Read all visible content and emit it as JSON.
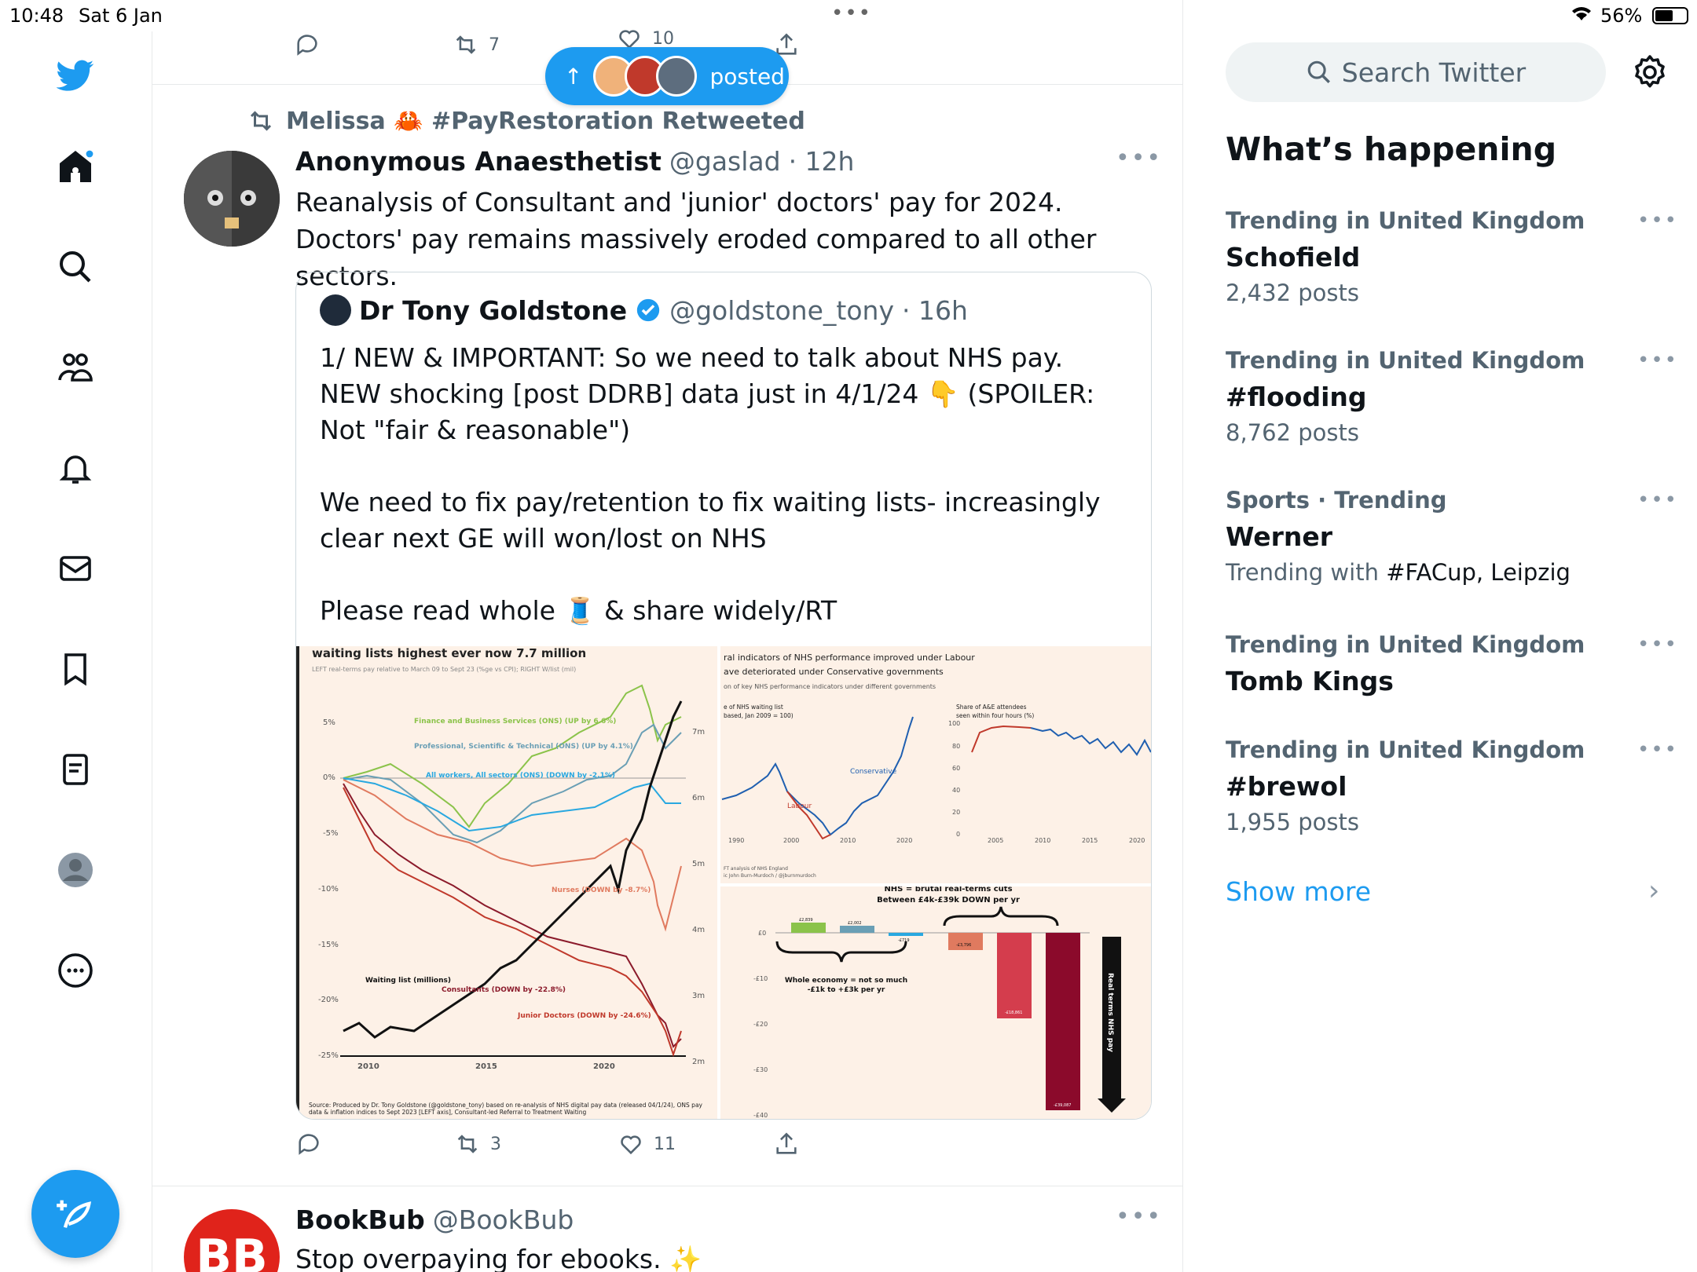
{
  "status_bar": {
    "time": "10:48",
    "date": "Sat 6 Jan",
    "battery": "56%"
  },
  "top_actions": {
    "retweets": "7",
    "likes": "10"
  },
  "new_posts_pill": {
    "label": "posted"
  },
  "tweet": {
    "retweeted_by": "Melissa 🦀 #PayRestoration Retweeted",
    "name": "Anonymous Anaesthetist",
    "handle": "@gaslad",
    "time": "· 12h",
    "text": "Reanalysis of Consultant and 'junior' doctors' pay for 2024. Doctors' pay remains massively eroded compared to all other sectors.",
    "quote": {
      "name": "Dr Tony Goldstone",
      "handle": "@goldstone_tony",
      "time": "· 16h",
      "text": "1/ NEW & IMPORTANT: So we need to talk about NHS pay. NEW shocking [post DDRB] data just in 4/1/24 👇 (SPOILER: Not \"fair & reasonable\")\n\nWe need to fix pay/retention to fix waiting lists- increasingly clear next GE will won/lost on NHS\n\nPlease read whole 🧵 & share widely/RT"
    },
    "actions": {
      "replies": "",
      "retweets": "3",
      "likes": "11"
    }
  },
  "images": {
    "left": {
      "title": "waiting lists highest ever now 7.7 million",
      "subtitle": "LEFT real-terms pay relative to March 09 to Sept 23 (%ge vs CPI); RIGHT W/list (mil)",
      "y_ticks_left": [
        "5%",
        "0%",
        "-5%",
        "-10%",
        "-15%",
        "-20%",
        "-25%"
      ],
      "y_ticks_right": [
        "7m",
        "6m",
        "5m",
        "4m",
        "3m",
        "2m"
      ],
      "x_ticks": [
        "2010",
        "2015",
        "2020"
      ],
      "labels": {
        "finance": "Finance and Business Services (ONS) (UP by 6.6%)",
        "professional": "Professional, Scientific & Technical (ONS) (UP by 4.1%)",
        "all_workers": "All workers, All sectors (ONS) (DOWN by -2.1%)",
        "nurses": "Nurses (DOWN by -8.7%)",
        "waiting": "Waiting list (millions)",
        "consultants": "Consultants (DOWN by -22.8%)",
        "junior": "Junior Doctors (DOWN by -24.6%)"
      },
      "source": "Source: Produced by Dr. Tony Goldstone (@goldstone_tony) based on re-analysis of NHS digital pay data (released 04/1/24), ONS pay data & inflation indices to Sept 2023 [LEFT axis], Consultant-led Referral to Treatment Waiting"
    },
    "top_right": {
      "title1": "ral indicators of NHS performance improved under Labour",
      "title2": "ave deteriorated under Conservative governments",
      "subtitle": "on of key NHS performance indicators under different governments",
      "panel1_title": "e of NHS waiting list",
      "panel1_sub": "based, Jan 2009 = 100)",
      "panel2_title": "Share of A&E attendees",
      "panel2_sub": "seen within four hours (%)",
      "conservative": "Conservative",
      "labour": "Labour",
      "x1": [
        "1990",
        "2000",
        "2010",
        "2020"
      ],
      "x2": [
        "2005",
        "2010",
        "2015",
        "2020"
      ],
      "y2": [
        "100",
        "80",
        "60",
        "40",
        "20",
        "0"
      ],
      "source1": "FT analysis of NHS England",
      "source2": "ic John Burn-Murdoch / @jburnmurdoch"
    },
    "bottom_right": {
      "title": "NHS = brutal real-terms cuts",
      "subtitle": "Between £4k-£39k DOWN per yr",
      "y_ticks": [
        "£0",
        "-£10",
        "-£20",
        "-£30",
        "-£40"
      ],
      "whole_economy": "Whole economy = not so much",
      "whole_economy2": "-£1k to +£3k per yr",
      "axis_label": "Real terms NHS pay",
      "bar_labels": [
        "£2,839",
        "£2,002",
        "-£719",
        "-£3,796",
        "-£18,861",
        "-£39,087"
      ]
    }
  },
  "tweet2": {
    "name": "BookBub",
    "handle": "@BookBub",
    "text": "Stop overpaying for ebooks. ✨",
    "avatar": "BB"
  },
  "sidebar": {
    "search_placeholder": "Search Twitter",
    "heading": "What’s happening",
    "trends": [
      {
        "context": "Trending in United Kingdom",
        "title": "Schofield",
        "count": "2,432 posts"
      },
      {
        "context": "Trending in United Kingdom",
        "title": "#flooding",
        "count": "8,762 posts"
      },
      {
        "context": "Sports · Trending",
        "title": "Werner",
        "count_prefix": "Trending with ",
        "count_link": "#FACup, Leipzig"
      },
      {
        "context": "Trending in United Kingdom",
        "title": "Tomb Kings",
        "count": ""
      },
      {
        "context": "Trending in United Kingdom",
        "title": "#brewol",
        "count": "1,955 posts"
      }
    ],
    "show_more": "Show more"
  },
  "colors": {
    "accent": "#1d9bf0",
    "text": "#0f1419",
    "muted": "#536471",
    "chart_bg": "#fdf1e7"
  }
}
